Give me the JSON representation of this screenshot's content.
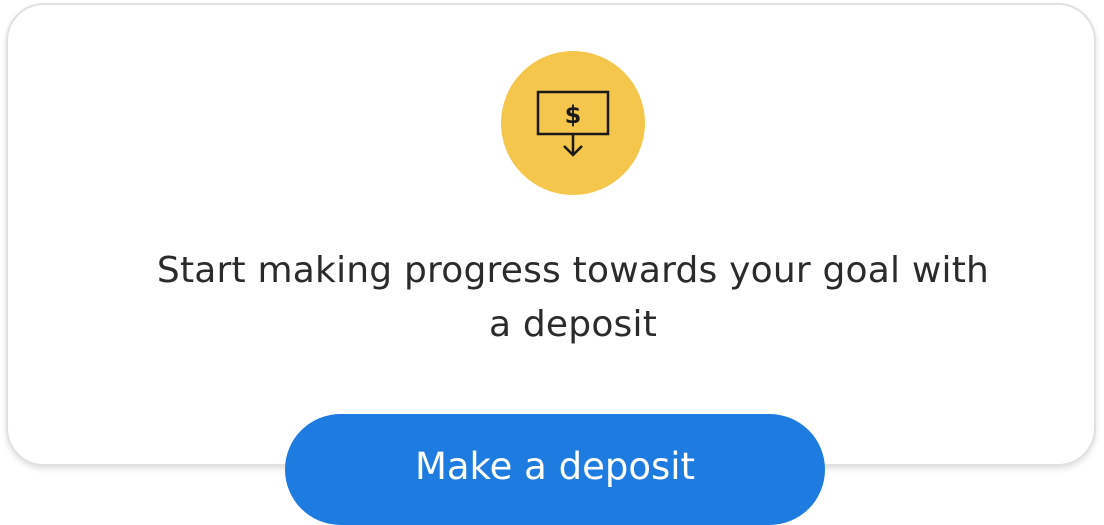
{
  "icon": {
    "name": "deposit-icon",
    "symbol": "$",
    "background_color": "#f4c64b"
  },
  "message": "Start making progress towards your goal with a deposit",
  "button": {
    "label": "Make a deposit",
    "color": "#1e7be0"
  }
}
